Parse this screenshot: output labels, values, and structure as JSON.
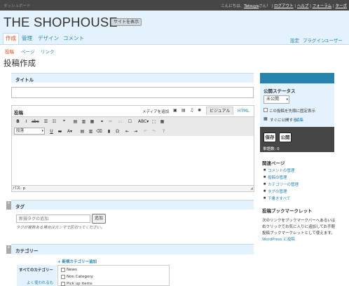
{
  "topbar": {
    "dashboard": "ダッシュボード",
    "user_line_prefix": "こんにちは、",
    "username": "Tatsuya",
    "user_suffix": "さん！",
    "logout": "ログアウト",
    "help": "ヘルプ",
    "forum": "フォーラム",
    "extra": "ターボ"
  },
  "header": {
    "site_title": "THE SHOPHOUSE",
    "view_site": "サイトを表示",
    "menu": [
      "作成",
      "管理",
      "デザイン",
      "コメント"
    ],
    "right_menu": [
      "設定",
      "プラグイン",
      "ユーザー"
    ]
  },
  "submenu": [
    "投稿",
    "ページ",
    "リンク"
  ],
  "page_title": "投稿作成",
  "title_box": {
    "label": "タイトル",
    "value": ""
  },
  "post_box": {
    "label": "投稿",
    "media_label": "メディアを追加",
    "tab_visual": "ビジュアル",
    "tab_html": "HTML",
    "format_select": "段落",
    "path": "パス: p"
  },
  "tags_box": {
    "label": "タグ",
    "placeholder": "新規タグの追加",
    "add_button": "追加",
    "hint": "タグが複数ある場合はカンマで区切ってください。"
  },
  "category_box": {
    "label": "カテゴリー",
    "add_link": "+ 新規カテゴリー追加",
    "tab_all": "すべてのカテゴリー",
    "tab_popular": "よく使われるもの",
    "items": [
      "News",
      "Non Category",
      "Pick up items"
    ]
  },
  "publish_box": {
    "status_label": "公開ステータス",
    "status_value": "未公開",
    "sticky_label": "この投稿を先頭に固定表示",
    "immediately_label": "すぐに公開する",
    "edit_link": "編集",
    "save_button": "保存",
    "publish_button": "公開",
    "word_count": "単語数: 0"
  },
  "related": {
    "label": "関連ページ",
    "items": [
      "コメントの管理",
      "投稿の管理",
      "カテゴリーの管理",
      "タグの管理",
      "下書きすべて"
    ]
  },
  "bookmarklet": {
    "label": "投稿ブックマークレット",
    "text": "次のリンクをブックマークバーへあるいは右クリックでお気に入りに追加してお手軽投稿ブックマークレットとして使えます。",
    "link": "WordPress に投稿"
  },
  "colors": {
    "accent": "#2583ad",
    "current": "#d54e21",
    "header_bg": "#e4f2fd",
    "topbar_bg": "#464646"
  }
}
